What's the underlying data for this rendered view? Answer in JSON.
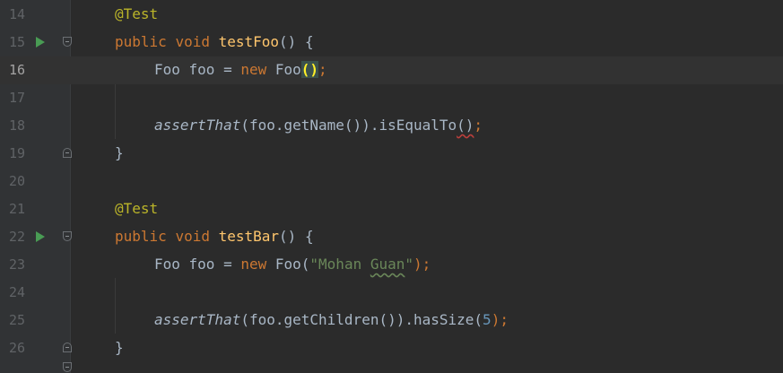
{
  "editor": {
    "lines": [
      {
        "num": "14",
        "parts": [
          "@Test"
        ]
      },
      {
        "num": "15",
        "parts": [
          "public",
          "void",
          "testFoo",
          "() {"
        ]
      },
      {
        "num": "16",
        "parts": [
          "Foo foo = ",
          "new",
          " Foo",
          "()",
          ";"
        ]
      },
      {
        "num": "17",
        "parts": []
      },
      {
        "num": "18",
        "parts": [
          "assertThat",
          "(foo.getName()).isEqualTo",
          "()",
          ";"
        ]
      },
      {
        "num": "19",
        "parts": [
          "}"
        ]
      },
      {
        "num": "20",
        "parts": []
      },
      {
        "num": "21",
        "parts": [
          "@Test"
        ]
      },
      {
        "num": "22",
        "parts": [
          "public",
          "void",
          "testBar",
          "() {"
        ]
      },
      {
        "num": "23",
        "parts": [
          "Foo foo = ",
          "new",
          " Foo(",
          "\"Mohan ",
          "Guan",
          "\"",
          ");"
        ]
      },
      {
        "num": "24",
        "parts": []
      },
      {
        "num": "25",
        "parts": [
          "assertThat",
          "(foo.getChildren()).hasSize(",
          "5",
          ");"
        ]
      },
      {
        "num": "26",
        "parts": [
          "}"
        ]
      }
    ],
    "current_line": "16",
    "colors": {
      "background": "#2b2b2b",
      "annotation": "#bbb529",
      "keyword": "#cc7832",
      "method": "#ffc66d",
      "string": "#6a8759",
      "number": "#6897bb",
      "run_icon": "#499c54"
    },
    "icons": [
      "run-test-icon",
      "fold-icon"
    ]
  }
}
